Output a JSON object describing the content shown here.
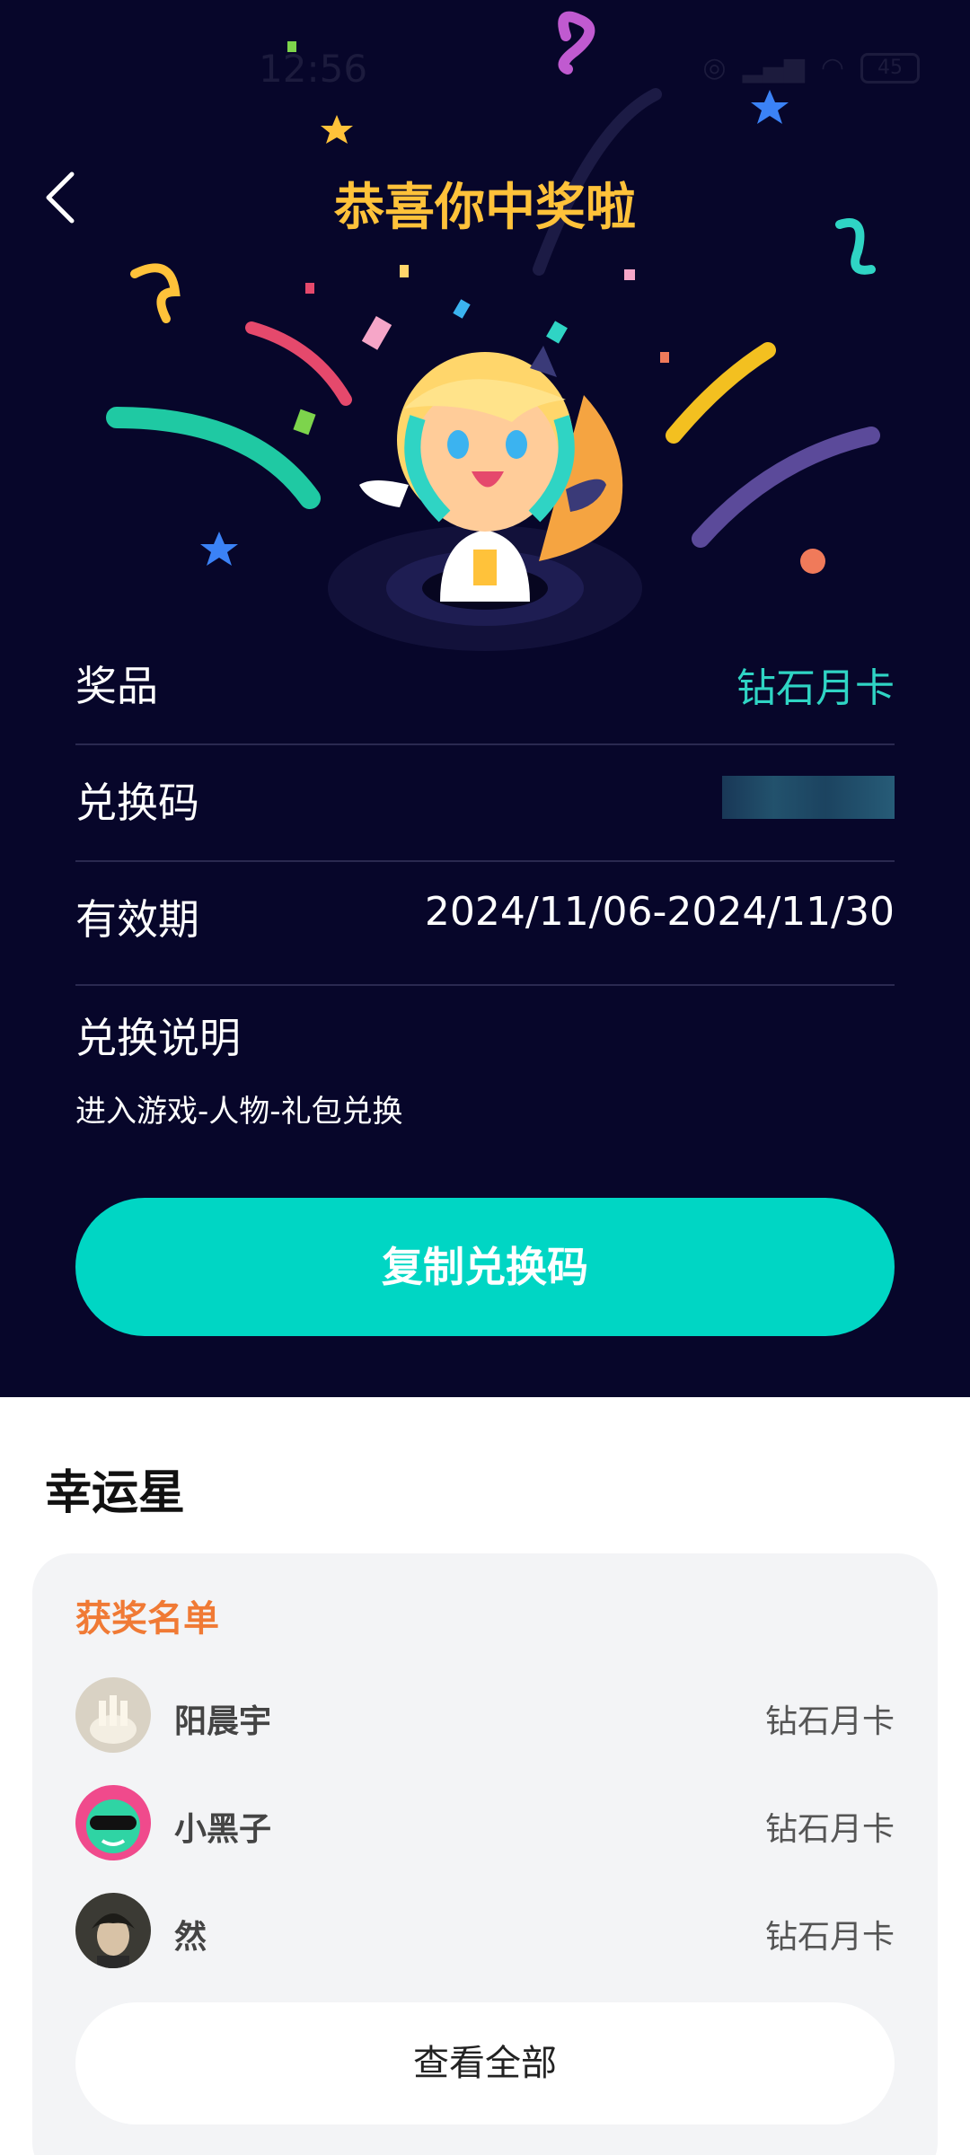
{
  "status": {
    "time": "12:56",
    "battery": "45"
  },
  "header": {
    "title": "恭喜你中奖啦"
  },
  "details": {
    "prize_label": "奖品",
    "prize_value": "钻石月卡",
    "code_label": "兑换码",
    "validity_label": "有效期",
    "validity_value": "2024/11/06-2024/11/30",
    "instructions_label": "兑换说明",
    "instructions_text": "进入游戏-人物-礼包兑换"
  },
  "copy_button": "复制兑换码",
  "lucky": {
    "title": "幸运星",
    "list_title": "获奖名单",
    "winners": [
      {
        "name": "阳晨宇",
        "prize": "钻石月卡"
      },
      {
        "name": "小黑子",
        "prize": "钻石月卡"
      },
      {
        "name": "然",
        "prize": "钻石月卡"
      }
    ],
    "view_all": "查看全部"
  },
  "colors": {
    "bg": "#07062a",
    "accent": "#00d6c4",
    "title": "#ffc23a",
    "list_title": "#f07a35"
  }
}
